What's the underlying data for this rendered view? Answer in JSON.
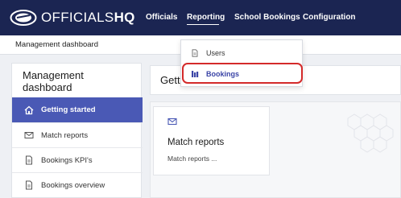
{
  "app": {
    "logo_text": "OFFICIALS",
    "logo_text_bold": "HQ"
  },
  "navbar": {
    "items": [
      {
        "label": "Officials"
      },
      {
        "label": "Reporting"
      },
      {
        "label": "School Bookings"
      },
      {
        "label": "Configuration"
      }
    ],
    "active": "Reporting"
  },
  "breadcrumb": {
    "label": "Management dashboard"
  },
  "reporting_menu": {
    "items": [
      {
        "label": "Users",
        "icon": "document-icon"
      },
      {
        "label": "Bookings",
        "icon": "bookings-icon"
      }
    ],
    "highlighted": "Bookings"
  },
  "sidebar": {
    "title": "Management dashboard",
    "items": [
      {
        "label": "Getting started",
        "icon": "home-icon"
      },
      {
        "label": "Match reports",
        "icon": "envelope-icon"
      },
      {
        "label": "Bookings KPI's",
        "icon": "document-icon"
      },
      {
        "label": "Bookings overview",
        "icon": "document-icon"
      }
    ],
    "active": "Getting started"
  },
  "main": {
    "header_title": "Getting started",
    "tile": {
      "title": "Match reports",
      "subtitle": "Match reports ...",
      "icon": "envelope-icon"
    }
  },
  "colors": {
    "navbar": "#1b2552",
    "active_sidebar": "#4a59b5",
    "highlight_ring": "#d42a2a"
  }
}
